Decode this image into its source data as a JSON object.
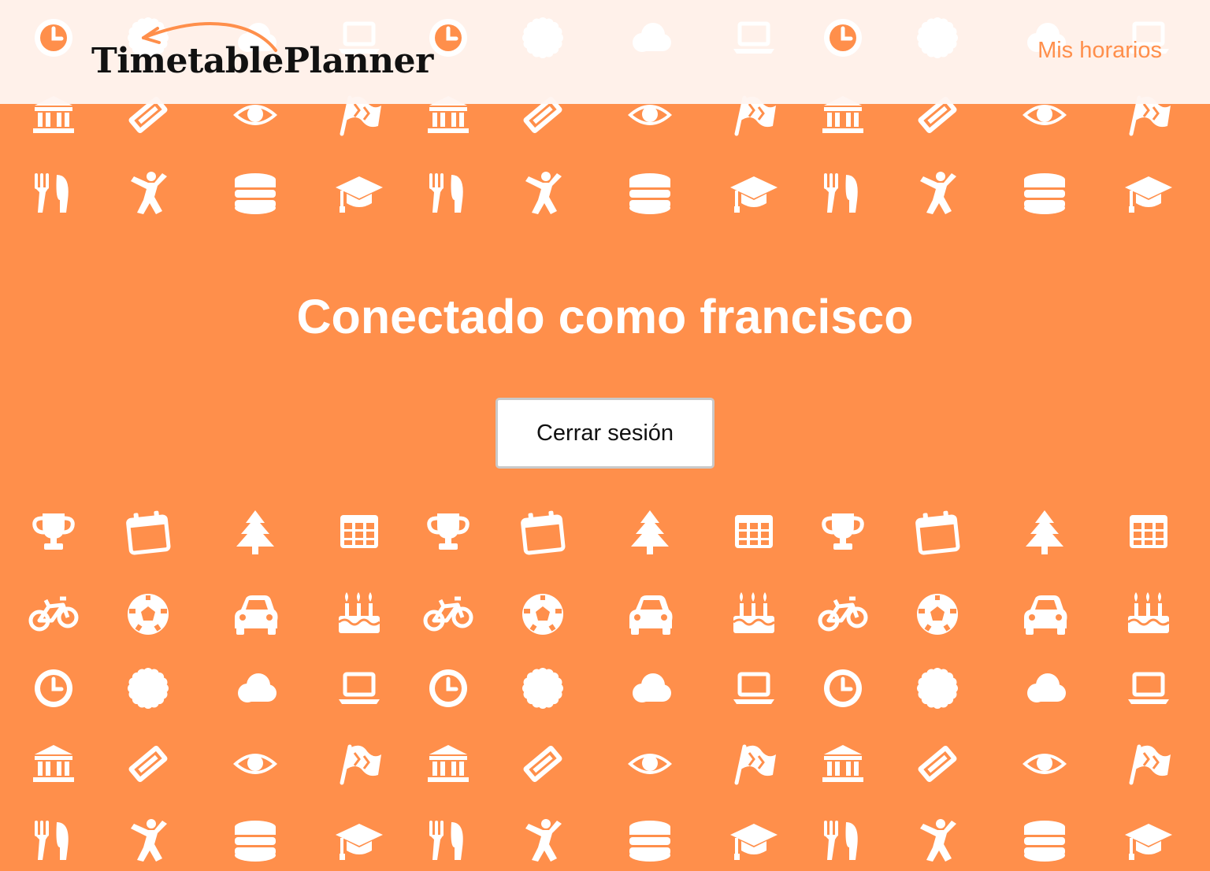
{
  "brand": {
    "name": "TimetablePlanner"
  },
  "nav": {
    "my_schedules": "Mis horarios"
  },
  "hero": {
    "title": "Conectado como francisco",
    "logout_label": "Cerrar sesión"
  },
  "colors": {
    "background": "#ff8f4b",
    "header_background": "#fff5f0",
    "accent": "#ff8f4b",
    "pattern_icon": "#ffffff",
    "title_text": "#ffffff",
    "button_background": "#ffffff",
    "button_border": "#c9c9c9"
  },
  "pattern": {
    "icon_sets": [
      [
        "clock-icon",
        "badge-icon",
        "cloud-icon",
        "laptop-icon"
      ],
      [
        "museum-icon",
        "ticket-icon",
        "eye-icon",
        "flag-icon"
      ],
      [
        "restaurant-icon",
        "person-icon",
        "database-icon",
        "graduation-cap-icon"
      ],
      [
        "trophy-icon",
        "calendar-icon",
        "tree-icon",
        "table-icon"
      ],
      [
        "bicycle-icon",
        "soccer-ball-icon",
        "car-icon",
        "cake-icon"
      ]
    ],
    "rows": [
      0,
      1,
      2,
      3,
      4,
      0,
      1,
      2
    ]
  }
}
